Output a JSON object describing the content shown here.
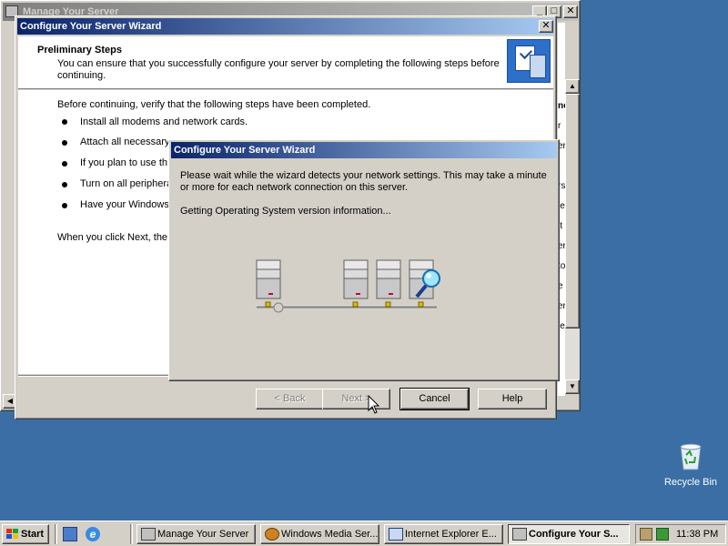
{
  "background_window": {
    "title": "Manage Your Server",
    "right_edge_fragments": [
      "ne",
      "r",
      "er",
      "i",
      "rs",
      "ie",
      "it",
      "er",
      "to",
      "e",
      "er",
      "ie"
    ]
  },
  "wizard": {
    "title": "Configure Your Server Wizard",
    "header_title": "Preliminary Steps",
    "header_subtitle": "You can ensure that you successfully configure your server by completing the following steps before continuing.",
    "intro": "Before continuing, verify that the following steps have been completed.",
    "steps": [
      "Install all modems and network cards.",
      "Attach all necessary ca",
      "If you plan to use th",
      "Turn on all periphera",
      "Have your Windows"
    ],
    "footer_text": "When you click Next, the",
    "buttons": {
      "back": "< Back",
      "next": "Next >",
      "cancel": "Cancel",
      "help": "Help"
    }
  },
  "progress_dialog": {
    "title": "Configure Your Server Wizard",
    "message": "Please wait while the wizard detects your network settings. This may take a minute or more for each network connection on this server.",
    "status": "Getting Operating System version information..."
  },
  "desktop": {
    "recycle_bin_label": "Recycle Bin"
  },
  "taskbar": {
    "start_label": "Start",
    "tasks": [
      {
        "label": "Manage Your Server",
        "active": false
      },
      {
        "label": "Windows Media Ser...",
        "active": false
      },
      {
        "label": "Internet Explorer E...",
        "active": false
      },
      {
        "label": "Configure Your S...",
        "active": true
      }
    ],
    "clock": "11:38 PM"
  },
  "colors": {
    "desktop": "#3a6ea5",
    "active_title_start": "#0a246a",
    "active_title_end": "#a6caf0",
    "face": "#d4d0c8"
  }
}
